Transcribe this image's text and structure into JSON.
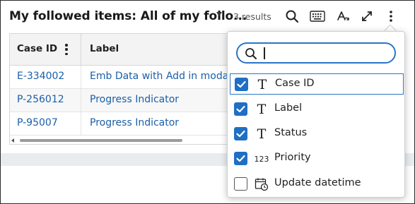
{
  "header": {
    "title": "My followed items: All of my follo...",
    "results": "3 results",
    "icons": [
      "search-icon",
      "keyboard-icon",
      "text-style-icon",
      "expand-icon",
      "more-vertical-icon"
    ]
  },
  "table": {
    "columns": [
      {
        "label": "Case ID"
      },
      {
        "label": "Label"
      }
    ],
    "rows": [
      {
        "case_id": "E-334002",
        "label": "Emb Data with Add in moda"
      },
      {
        "case_id": "P-256012",
        "label": "Progress Indicator"
      },
      {
        "case_id": "P-95007",
        "label": "Progress Indicator"
      }
    ]
  },
  "column_picker": {
    "search": {
      "value": "",
      "placeholder": ""
    },
    "options": [
      {
        "label": "Case ID",
        "icon": "T",
        "type": "text-type-icon",
        "checked": true
      },
      {
        "label": "Label",
        "icon": "T",
        "type": "text-type-icon",
        "checked": true
      },
      {
        "label": "Status",
        "icon": "T",
        "type": "text-type-icon",
        "checked": true
      },
      {
        "label": "Priority",
        "icon": "123",
        "type": "number-type-icon",
        "checked": true
      },
      {
        "label": "Update datetime",
        "icon": "",
        "type": "calendar-clock-icon",
        "checked": false
      }
    ]
  },
  "colors": {
    "accent": "#1f6fc4",
    "link": "#1a5fa8",
    "header_bg": "#f3f3f3",
    "band_bg": "#e9ecef"
  }
}
